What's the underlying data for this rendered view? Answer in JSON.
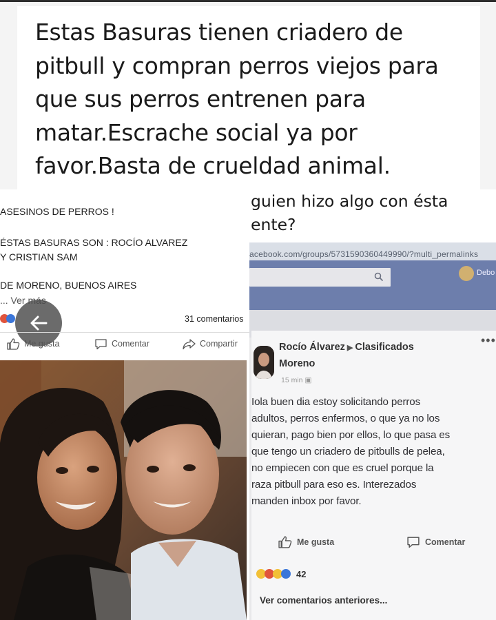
{
  "headline": {
    "lines": [
      "Estas Basuras tienen criadero de",
      "pitbull y compran perros viejos para",
      "que sus perros entrenen para",
      "matar.Escrache social ya por",
      "favor.Basta de crueldad animal."
    ]
  },
  "left_post": {
    "line1": "ASESINOS DE PERROS !",
    "line2": "ÉSTAS BASURAS SON : ROCÍO ALVAREZ",
    "line3": "Y CRISTIAN SAM",
    "line4": "DE MORENO, BUENOS AIRES",
    "see_more": "... Ver más",
    "comments_count": "31 comentarios",
    "like_label": "Me gusta",
    "comment_label": "Comentar",
    "share_label": "Compartir"
  },
  "right_caption": {
    "lines": [
      "guien hizo algo con ésta",
      "ente?"
    ]
  },
  "screenshot": {
    "url": "acebook.com/groups/5731590360449990/?multi_permalinks",
    "user_name": "Debo",
    "author": "Rocío Álvarez",
    "group": "Clasificados",
    "group_line2": "Moreno",
    "time": "15 min",
    "more_icon": "•••",
    "body_lines": [
      "Iola buen dia estoy solicitando perros",
      "adultos, perros enfermos, o que ya no los",
      "quieran, pago bien por ellos, lo que pasa es",
      "que tengo un criadero de pitbulls de pelea,",
      "no empiecen con que es cruel porque la",
      "raza pitbull para eso es. Interezados",
      "manden inbox por favor."
    ],
    "like_label": "Me gusta",
    "comment_label": "Comentar",
    "reaction_count": "42",
    "previous_comments": "Ver comentarios anteriores..."
  },
  "colors": {
    "fb_blue": "#6d7eac",
    "like_blue": "#3b5998",
    "reaction_red": "#e0543c",
    "reaction_yellow": "#f2c037"
  }
}
